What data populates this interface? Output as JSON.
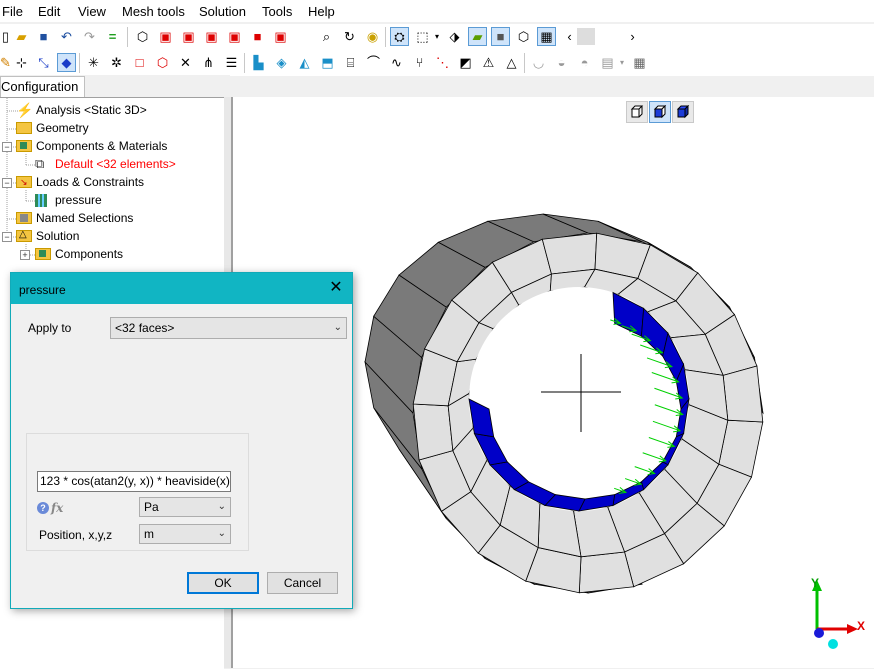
{
  "menu": [
    "File",
    "Edit",
    "View",
    "Mesh tools",
    "Solution",
    "Tools",
    "Help"
  ],
  "tab": {
    "label": "Configuration"
  },
  "tree": {
    "items": [
      {
        "label": "Analysis <Static 3D>",
        "icon": "lightning-icon"
      },
      {
        "label": "Geometry",
        "icon": "folder-icon"
      },
      {
        "label": "Components & Materials",
        "icon": "components-icon"
      },
      {
        "label": "Default <32 elements>",
        "icon": "component-icon",
        "color": "#ff0000"
      },
      {
        "label": "Loads & Constraints",
        "icon": "loads-icon"
      },
      {
        "label": "pressure",
        "icon": "pressure-icon"
      },
      {
        "label": "Named Selections",
        "icon": "named-selection-icon"
      },
      {
        "label": "Solution",
        "icon": "solution-icon"
      },
      {
        "label": "Components",
        "icon": "components-icon"
      }
    ]
  },
  "dialog": {
    "title": "pressure",
    "apply_to_label": "Apply to",
    "apply_to_value": "<32 faces>",
    "expression": "123 * cos(atan2(y, x)) * heaviside(x)",
    "fx_label": "fx",
    "unit_value": "Pa",
    "position_label": "Position, x,y,z",
    "position_unit": "m",
    "ok_label": "OK",
    "cancel_label": "Cancel"
  },
  "axes": {
    "x_label": "X",
    "y_label": "Y"
  },
  "colors": {
    "accent": "#11b5c3",
    "mesh_fill": "#e0e0e0",
    "loaded_faces": "#0000c8",
    "arrows": "#00d000"
  }
}
